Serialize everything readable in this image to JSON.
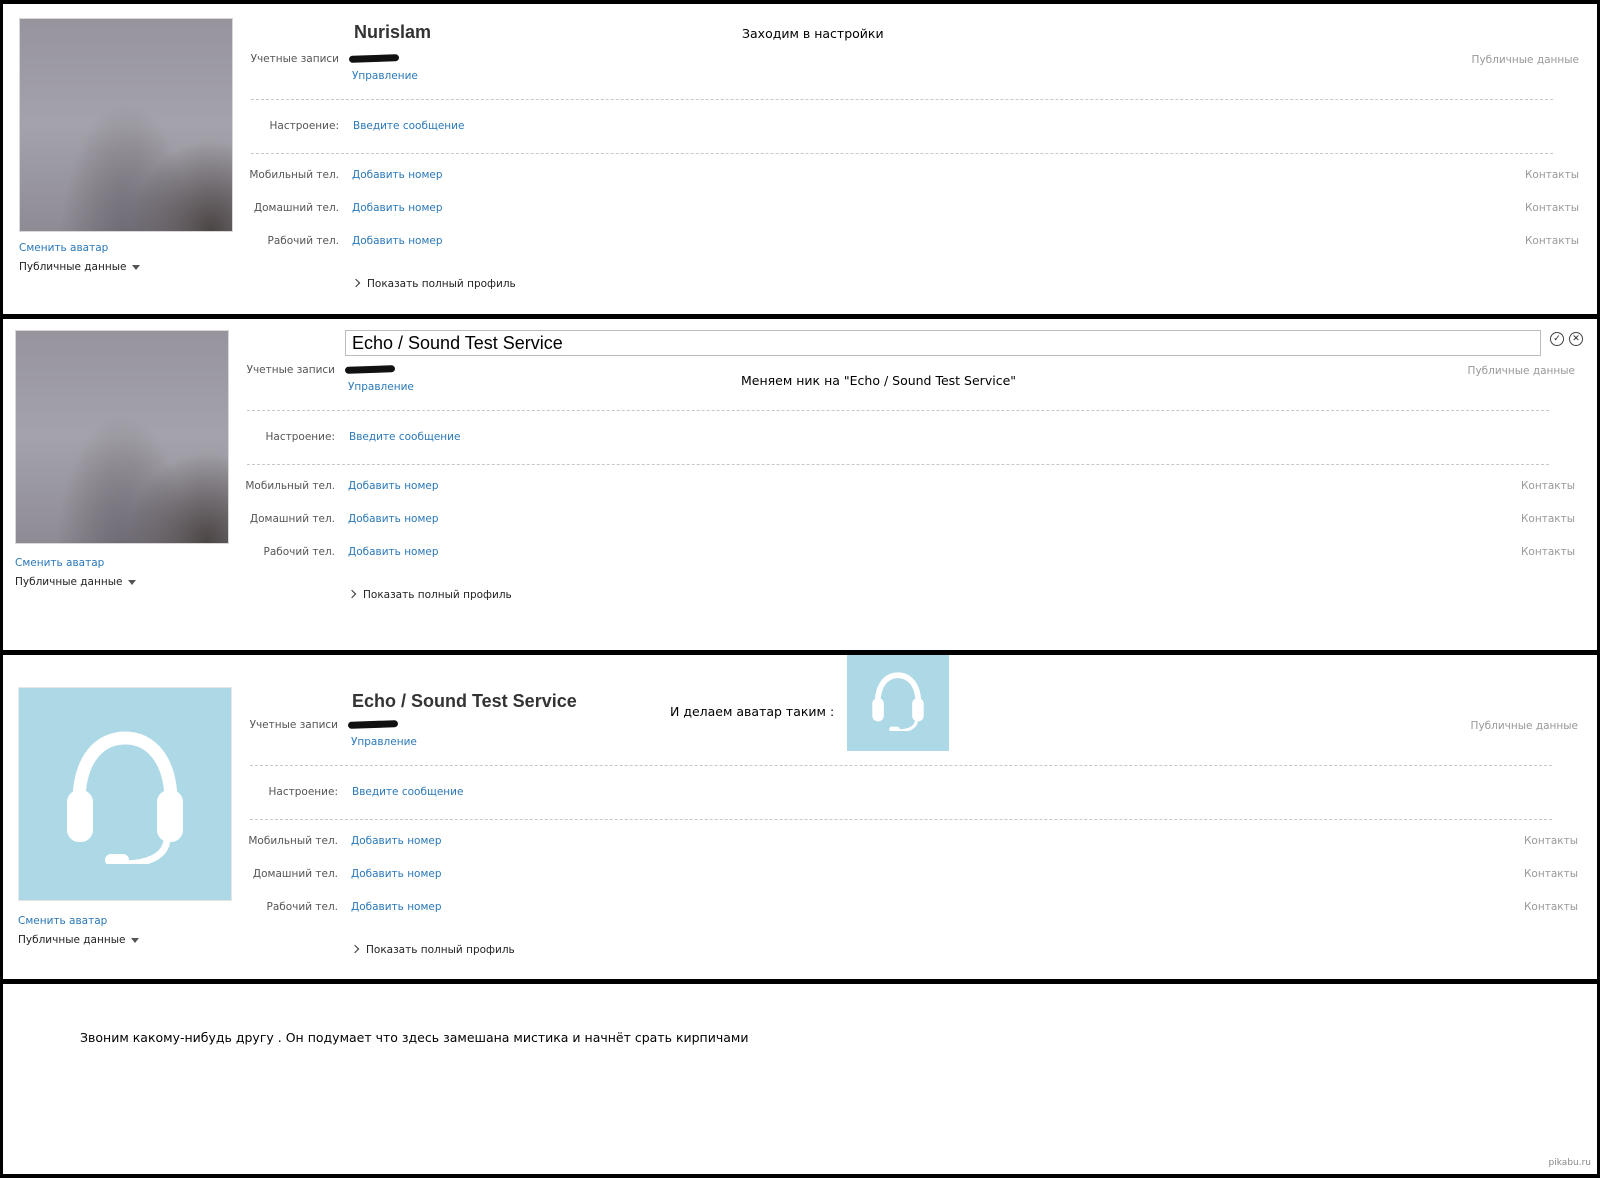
{
  "panels": [
    {
      "name": "Nurislam",
      "caption": "Заходим в настройки",
      "accounts_label": "Учетные записи",
      "manage_link": "Управление",
      "public_data_right": "Публичные данные",
      "mood_label": "Настроение:",
      "mood_link": "Введите сообщение",
      "mobile_label": "Мобильный тел.",
      "home_label": "Домашний тел.",
      "work_label": "Рабочий тел.",
      "add_number": "Добавить номер",
      "contacts": "Контакты",
      "show_full_profile": "Показать полный профиль",
      "change_avatar": "Сменить аватар",
      "public_data_dropdown": "Публичные данные"
    },
    {
      "name_input_value": "Echo / Sound Test Service",
      "caption": "Меняем ник на \"Echo / Sound Test Service\"",
      "accounts_label": "Учетные записи",
      "manage_link": "Управление",
      "public_data_right": "Публичные данные",
      "mood_label": "Настроение:",
      "mood_link": "Введите сообщение",
      "mobile_label": "Мобильный тел.",
      "home_label": "Домашний тел.",
      "work_label": "Рабочий тел.",
      "add_number": "Добавить номер",
      "contacts": "Контакты",
      "show_full_profile": "Показать полный профиль",
      "change_avatar": "Сменить аватар",
      "public_data_dropdown": "Публичные данные"
    },
    {
      "name": "Echo / Sound Test Service",
      "caption": "И делаем аватар таким :",
      "accounts_label": "Учетные записи",
      "manage_link": "Управление",
      "public_data_right": "Публичные данные",
      "mood_label": "Настроение:",
      "mood_link": "Введите сообщение",
      "mobile_label": "Мобильный тел.",
      "home_label": "Домашний тел.",
      "work_label": "Рабочий тел.",
      "add_number": "Добавить номер",
      "contacts": "Контакты",
      "show_full_profile": "Показать полный профиль",
      "change_avatar": "Сменить аватар",
      "public_data_dropdown": "Публичные данные"
    }
  ],
  "final_caption": "Звоним какому-нибудь другу . Он подумает что здесь замешана мистика и начнёт срать кирпичами",
  "watermark": "pikabu.ru",
  "icons": {
    "headset": "headset-icon",
    "confirm": "checkmark-circle-icon",
    "cancel": "close-circle-icon",
    "chevron": "chevron-right-icon",
    "caret": "caret-down-icon"
  },
  "colors": {
    "link": "#2a78b8",
    "avatar_bg": "#add8e6",
    "separator": "#000000"
  }
}
